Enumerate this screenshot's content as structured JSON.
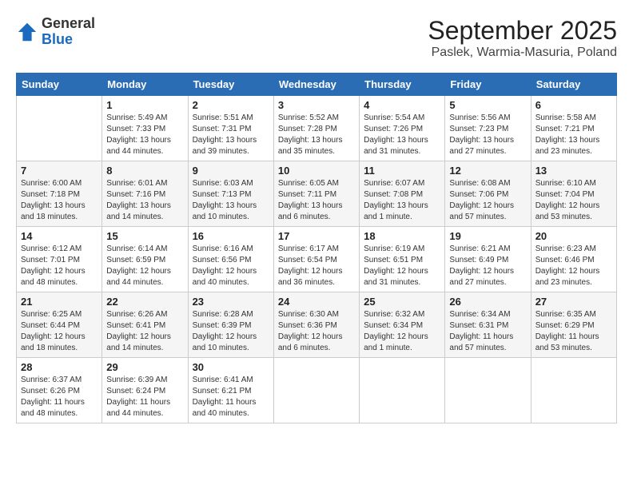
{
  "logo": {
    "general": "General",
    "blue": "Blue"
  },
  "header": {
    "title": "September 2025",
    "subtitle": "Paslek, Warmia-Masuria, Poland"
  },
  "days_of_week": [
    "Sunday",
    "Monday",
    "Tuesday",
    "Wednesday",
    "Thursday",
    "Friday",
    "Saturday"
  ],
  "weeks": [
    [
      {
        "day": "",
        "info": ""
      },
      {
        "day": "1",
        "info": "Sunrise: 5:49 AM\nSunset: 7:33 PM\nDaylight: 13 hours\nand 44 minutes."
      },
      {
        "day": "2",
        "info": "Sunrise: 5:51 AM\nSunset: 7:31 PM\nDaylight: 13 hours\nand 39 minutes."
      },
      {
        "day": "3",
        "info": "Sunrise: 5:52 AM\nSunset: 7:28 PM\nDaylight: 13 hours\nand 35 minutes."
      },
      {
        "day": "4",
        "info": "Sunrise: 5:54 AM\nSunset: 7:26 PM\nDaylight: 13 hours\nand 31 minutes."
      },
      {
        "day": "5",
        "info": "Sunrise: 5:56 AM\nSunset: 7:23 PM\nDaylight: 13 hours\nand 27 minutes."
      },
      {
        "day": "6",
        "info": "Sunrise: 5:58 AM\nSunset: 7:21 PM\nDaylight: 13 hours\nand 23 minutes."
      }
    ],
    [
      {
        "day": "7",
        "info": "Sunrise: 6:00 AM\nSunset: 7:18 PM\nDaylight: 13 hours\nand 18 minutes."
      },
      {
        "day": "8",
        "info": "Sunrise: 6:01 AM\nSunset: 7:16 PM\nDaylight: 13 hours\nand 14 minutes."
      },
      {
        "day": "9",
        "info": "Sunrise: 6:03 AM\nSunset: 7:13 PM\nDaylight: 13 hours\nand 10 minutes."
      },
      {
        "day": "10",
        "info": "Sunrise: 6:05 AM\nSunset: 7:11 PM\nDaylight: 13 hours\nand 6 minutes."
      },
      {
        "day": "11",
        "info": "Sunrise: 6:07 AM\nSunset: 7:08 PM\nDaylight: 13 hours\nand 1 minute."
      },
      {
        "day": "12",
        "info": "Sunrise: 6:08 AM\nSunset: 7:06 PM\nDaylight: 12 hours\nand 57 minutes."
      },
      {
        "day": "13",
        "info": "Sunrise: 6:10 AM\nSunset: 7:04 PM\nDaylight: 12 hours\nand 53 minutes."
      }
    ],
    [
      {
        "day": "14",
        "info": "Sunrise: 6:12 AM\nSunset: 7:01 PM\nDaylight: 12 hours\nand 48 minutes."
      },
      {
        "day": "15",
        "info": "Sunrise: 6:14 AM\nSunset: 6:59 PM\nDaylight: 12 hours\nand 44 minutes."
      },
      {
        "day": "16",
        "info": "Sunrise: 6:16 AM\nSunset: 6:56 PM\nDaylight: 12 hours\nand 40 minutes."
      },
      {
        "day": "17",
        "info": "Sunrise: 6:17 AM\nSunset: 6:54 PM\nDaylight: 12 hours\nand 36 minutes."
      },
      {
        "day": "18",
        "info": "Sunrise: 6:19 AM\nSunset: 6:51 PM\nDaylight: 12 hours\nand 31 minutes."
      },
      {
        "day": "19",
        "info": "Sunrise: 6:21 AM\nSunset: 6:49 PM\nDaylight: 12 hours\nand 27 minutes."
      },
      {
        "day": "20",
        "info": "Sunrise: 6:23 AM\nSunset: 6:46 PM\nDaylight: 12 hours\nand 23 minutes."
      }
    ],
    [
      {
        "day": "21",
        "info": "Sunrise: 6:25 AM\nSunset: 6:44 PM\nDaylight: 12 hours\nand 18 minutes."
      },
      {
        "day": "22",
        "info": "Sunrise: 6:26 AM\nSunset: 6:41 PM\nDaylight: 12 hours\nand 14 minutes."
      },
      {
        "day": "23",
        "info": "Sunrise: 6:28 AM\nSunset: 6:39 PM\nDaylight: 12 hours\nand 10 minutes."
      },
      {
        "day": "24",
        "info": "Sunrise: 6:30 AM\nSunset: 6:36 PM\nDaylight: 12 hours\nand 6 minutes."
      },
      {
        "day": "25",
        "info": "Sunrise: 6:32 AM\nSunset: 6:34 PM\nDaylight: 12 hours\nand 1 minute."
      },
      {
        "day": "26",
        "info": "Sunrise: 6:34 AM\nSunset: 6:31 PM\nDaylight: 11 hours\nand 57 minutes."
      },
      {
        "day": "27",
        "info": "Sunrise: 6:35 AM\nSunset: 6:29 PM\nDaylight: 11 hours\nand 53 minutes."
      }
    ],
    [
      {
        "day": "28",
        "info": "Sunrise: 6:37 AM\nSunset: 6:26 PM\nDaylight: 11 hours\nand 48 minutes."
      },
      {
        "day": "29",
        "info": "Sunrise: 6:39 AM\nSunset: 6:24 PM\nDaylight: 11 hours\nand 44 minutes."
      },
      {
        "day": "30",
        "info": "Sunrise: 6:41 AM\nSunset: 6:21 PM\nDaylight: 11 hours\nand 40 minutes."
      },
      {
        "day": "",
        "info": ""
      },
      {
        "day": "",
        "info": ""
      },
      {
        "day": "",
        "info": ""
      },
      {
        "day": "",
        "info": ""
      }
    ]
  ]
}
